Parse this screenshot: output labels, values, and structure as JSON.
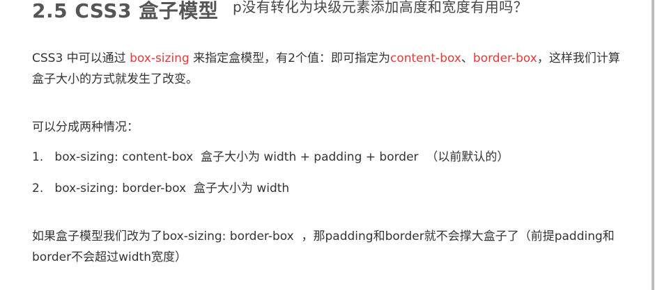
{
  "title": "2.5 CSS3 盒子模型",
  "overlay_question": "p没有转化为块级元素添加高度和宽度有用吗？",
  "intro": {
    "part1": "CSS3 中可以通过 ",
    "kw1": "box-sizing",
    "part2": " 来指定盒模型，有2个值：即可指定为",
    "kw2": "content-box",
    "sep": "、",
    "kw3": "border-box",
    "part3": "，这样我们计算盒子大小的方式就发生了改变。"
  },
  "cases_heading": "可以分成两种情况：",
  "cases": [
    "1.   box-sizing: content-box  盒子大小为 width + padding + border  （以前默认的）",
    "2.   box-sizing: border-box  盒子大小为 width"
  ],
  "conclusion": "如果盒子模型我们改为了box-sizing: border-box  ，那padding和border就不会撑大盒子了（前提padding和border不会超过width宽度）",
  "colors": {
    "keyword": "#e53935",
    "title": "#555555",
    "text": "#333333"
  }
}
